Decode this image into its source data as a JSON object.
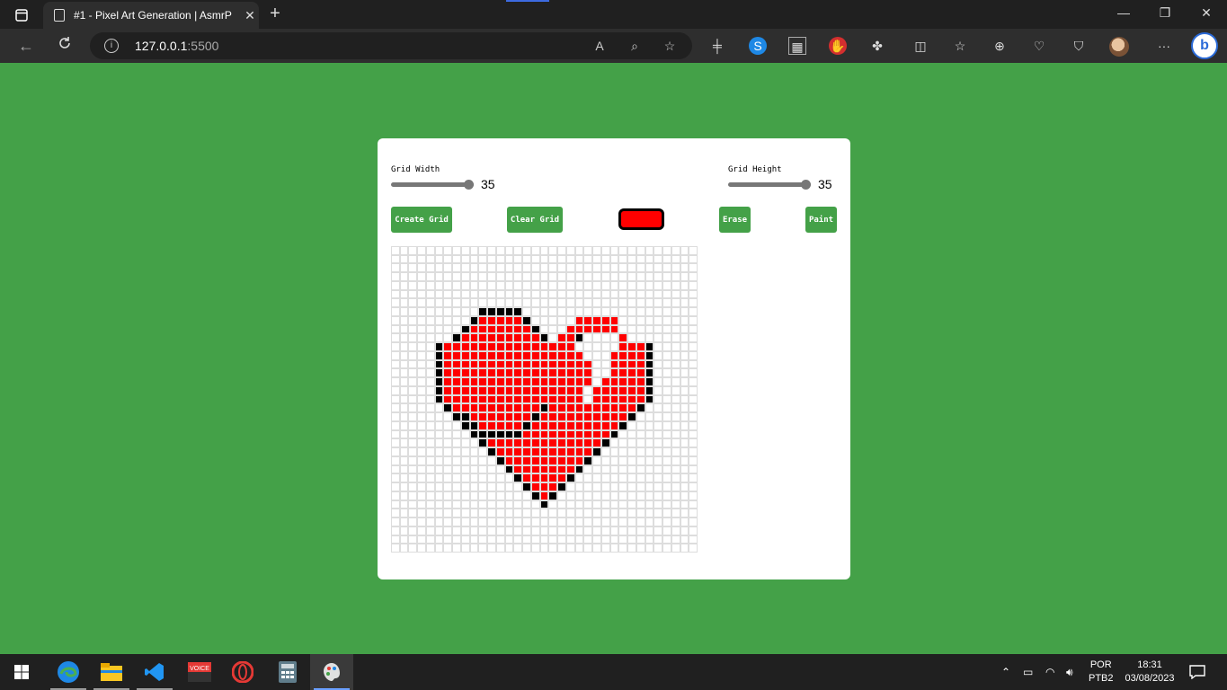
{
  "browser": {
    "tab_title": "#1 - Pixel Art Generation | AsmrP",
    "new_tab_symbol": "+",
    "close_symbol": "✕",
    "url_host": "127.0.0.1",
    "url_port": ":5500",
    "window_controls": [
      "—",
      "❐",
      "✕"
    ]
  },
  "app": {
    "width_label": "Grid Width",
    "width_value": "35",
    "width_level": 1.0,
    "height_label": "Grid Height",
    "height_value": "35",
    "height_level": 1.0,
    "buttons": {
      "create": "Create Grid",
      "clear": "Clear Grid",
      "erase": "Erase",
      "paint": "Paint"
    },
    "selected_color": "#ff0000",
    "accent_color": "#44a148",
    "grid_cols": 35,
    "grid_rows": 35,
    "pixels": {
      "black": [
        "7,10",
        "7,11",
        "7,12",
        "7,13",
        "7,14",
        "21,10",
        "21,11",
        "21,12",
        "21,13",
        "21,14",
        "8,9",
        "8,15",
        "20,9",
        "20,15",
        "9,8",
        "9,16",
        "19,8",
        "19,16",
        "10,7",
        "10,17",
        "10,21",
        "18,17",
        "18,28",
        "11,5",
        "11,29",
        "17,5",
        "17,29",
        "12,5",
        "12,29",
        "13,5",
        "13,29",
        "14,5",
        "14,29",
        "15,5",
        "15,29",
        "16,5",
        "16,29",
        "18,6",
        "19,7",
        "20,8",
        "21,9",
        "22,10",
        "23,11",
        "24,12",
        "25,13",
        "26,14",
        "27,15",
        "28,16",
        "18,28",
        "19,27",
        "20,26",
        "21,25",
        "22,24",
        "23,23",
        "24,22",
        "25,21",
        "26,20",
        "27,19",
        "28,18",
        "29,17"
      ],
      "white": [
        "10,21",
        "10,22",
        "10,23",
        "10,24",
        "10,25",
        "11,21",
        "11,22",
        "11,23",
        "11,24",
        "11,25",
        "12,22",
        "12,23",
        "12,24",
        "13,23",
        "13,24",
        "14,23",
        "14,24",
        "15,23",
        "16,22",
        "17,22"
      ]
    }
  },
  "taskbar": {
    "lang_top": "POR",
    "lang_bottom": "PTB2",
    "time": "18:31",
    "date": "03/08/2023",
    "apps": [
      "start",
      "edge",
      "file-explorer",
      "vscode",
      "voicemeeter",
      "opera",
      "calculator",
      "paint"
    ]
  }
}
